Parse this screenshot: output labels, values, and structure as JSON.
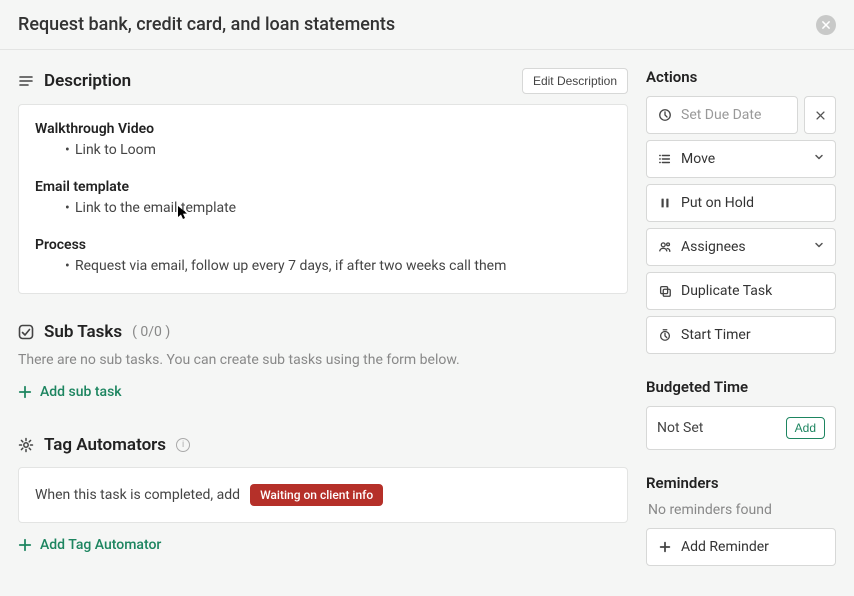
{
  "header": {
    "title": "Request bank, credit card, and loan statements"
  },
  "description": {
    "section_label": "Description",
    "edit_button": "Edit Description",
    "blocks": [
      {
        "heading": "Walkthrough Video",
        "bullet": "Link to Loom"
      },
      {
        "heading": "Email template",
        "bullet": "Link to the email template"
      },
      {
        "heading": "Process",
        "bullet": "Request via email, follow up every 7 days, if after two weeks call them"
      }
    ]
  },
  "subtasks": {
    "section_label": "Sub Tasks",
    "count_label": "( 0/0 )",
    "empty_message": "There are no sub tasks. You can create sub tasks using the form below.",
    "add_label": "Add sub task"
  },
  "tag_automators": {
    "section_label": "Tag Automators",
    "rule_text": "When this task is completed,  add",
    "tag_label": "Waiting on client info",
    "add_label": "Add Tag Automator"
  },
  "actions": {
    "section_label": "Actions",
    "set_due_date": "Set Due Date",
    "move": "Move",
    "put_on_hold": "Put on Hold",
    "assignees": "Assignees",
    "duplicate": "Duplicate Task",
    "start_timer": "Start Timer"
  },
  "budgeted_time": {
    "section_label": "Budgeted Time",
    "value": "Not Set",
    "add_label": "Add"
  },
  "reminders": {
    "section_label": "Reminders",
    "empty_message": "No reminders found",
    "add_label": "Add Reminder"
  }
}
